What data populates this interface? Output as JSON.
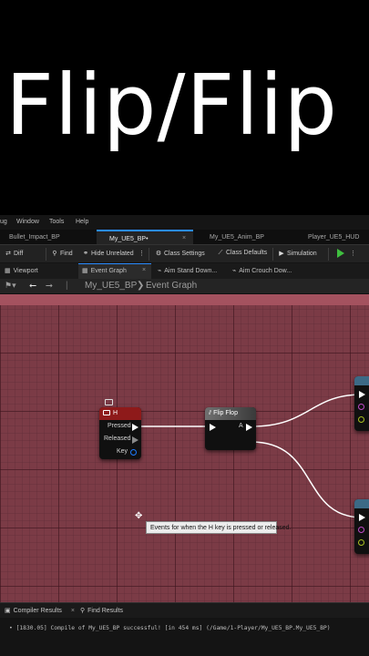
{
  "caption": {
    "text": "Flip/Flip"
  },
  "menu": {
    "items": [
      "ug",
      "Window",
      "Tools",
      "Help"
    ]
  },
  "tabs": [
    {
      "label": "Bullet_Impact_BP",
      "close": ""
    },
    {
      "label": "My_UE5_BP•",
      "close": "×"
    },
    {
      "label": "My_UE5_Anim_BP",
      "close": ""
    },
    {
      "label": "Player_UE5_HUD",
      "close": ""
    }
  ],
  "toolbar": {
    "diff_label": "Diff",
    "find_label": "Find",
    "hide_unrelated_label": "Hide Unrelated",
    "class_settings_label": "Class Settings",
    "class_defaults_label": "Class Defaults",
    "simulation_label": "Simulation"
  },
  "subtabs": [
    {
      "label": "Viewport"
    },
    {
      "label": "Event Graph",
      "close": "×"
    },
    {
      "label": "Aim Stand Down..."
    },
    {
      "label": "Aim Crouch Dow..."
    }
  ],
  "breadcrumb": {
    "blueprint": "My_UE5_BP",
    "separator": "❯",
    "graph": "Event Graph"
  },
  "nodes": {
    "h_key": {
      "title": "H",
      "pins": {
        "pressed": "Pressed",
        "released": "Released",
        "key": "Key"
      },
      "header_color": "#8e1a1a"
    },
    "flip_flop": {
      "title": "Flip Flop",
      "pin_a": "A",
      "header_color": "#5a5a5a"
    }
  },
  "tooltip": {
    "text": "Events for when the H key is pressed or released."
  },
  "bottom": {
    "tabs": [
      {
        "label": "Compiler Results",
        "close": "×"
      },
      {
        "label": "Find Results"
      }
    ],
    "log": "• [1830.05] Compile of My_UE5_BP successful! [in 454 ms] (/Game/1-Player/My_UE5_BP.My_UE5_BP)"
  },
  "colors": {
    "graph_bg": "#7b3b46",
    "accent": "#2a8cff",
    "play": "#3fbf3f"
  },
  "icons": [
    "diff-icon",
    "search-icon",
    "hide-unrelated-icon",
    "gear-icon",
    "class-defaults-icon",
    "simulation-icon",
    "play-icon",
    "back-icon",
    "forward-icon",
    "keyboard-icon",
    "flipflop-icon",
    "cursor-icon"
  ]
}
